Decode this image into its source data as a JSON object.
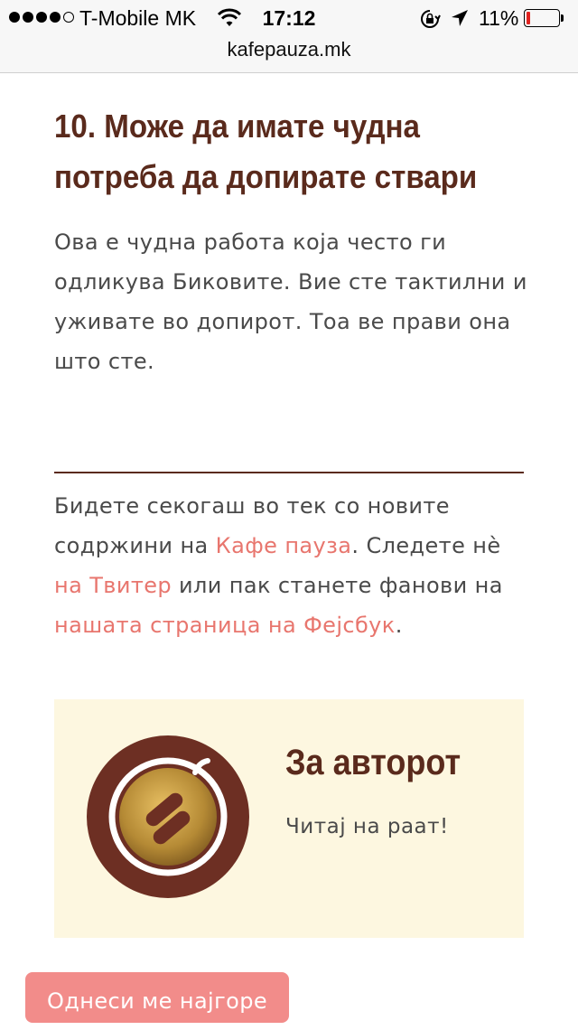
{
  "status_bar": {
    "carrier": "T-Mobile MK",
    "time": "17:12",
    "battery_percent": "11%",
    "battery_level": 0.11,
    "signal_bars": 4,
    "signal_max": 5,
    "icons": [
      "wifi-icon",
      "rotation-lock-icon",
      "location-arrow-icon",
      "battery-icon"
    ]
  },
  "browser": {
    "url": "kafepauza.mk"
  },
  "article": {
    "heading": "10. Може да имате чудна потреба да допирате ствари",
    "body": "Ова е чудна работа која често ги одликува Биковите. Вие сте тактилни и уживате во допирот. Тоа ве прави она што сте."
  },
  "follow": {
    "text_1": "Бидете секогаш во тек со новите содржини на ",
    "link_1": "Кафе пауза",
    "text_2": ". Следете нè ",
    "link_2": "на Твитер",
    "text_3": " или пак станете фанови на ",
    "link_3": "нашата страница на Фејсбук",
    "text_4": "."
  },
  "author": {
    "title": "За авторот",
    "description": "Читај на раат!",
    "avatar_icon": "coffee-cup-logo-icon"
  },
  "button": {
    "label": "Однеси ме најгоре"
  },
  "colors": {
    "heading": "#5a2a1c",
    "link": "#e8766e",
    "author_box_bg": "#fdf7e0",
    "button_bg": "#f28c8a",
    "battery_low": "#e0221f"
  }
}
